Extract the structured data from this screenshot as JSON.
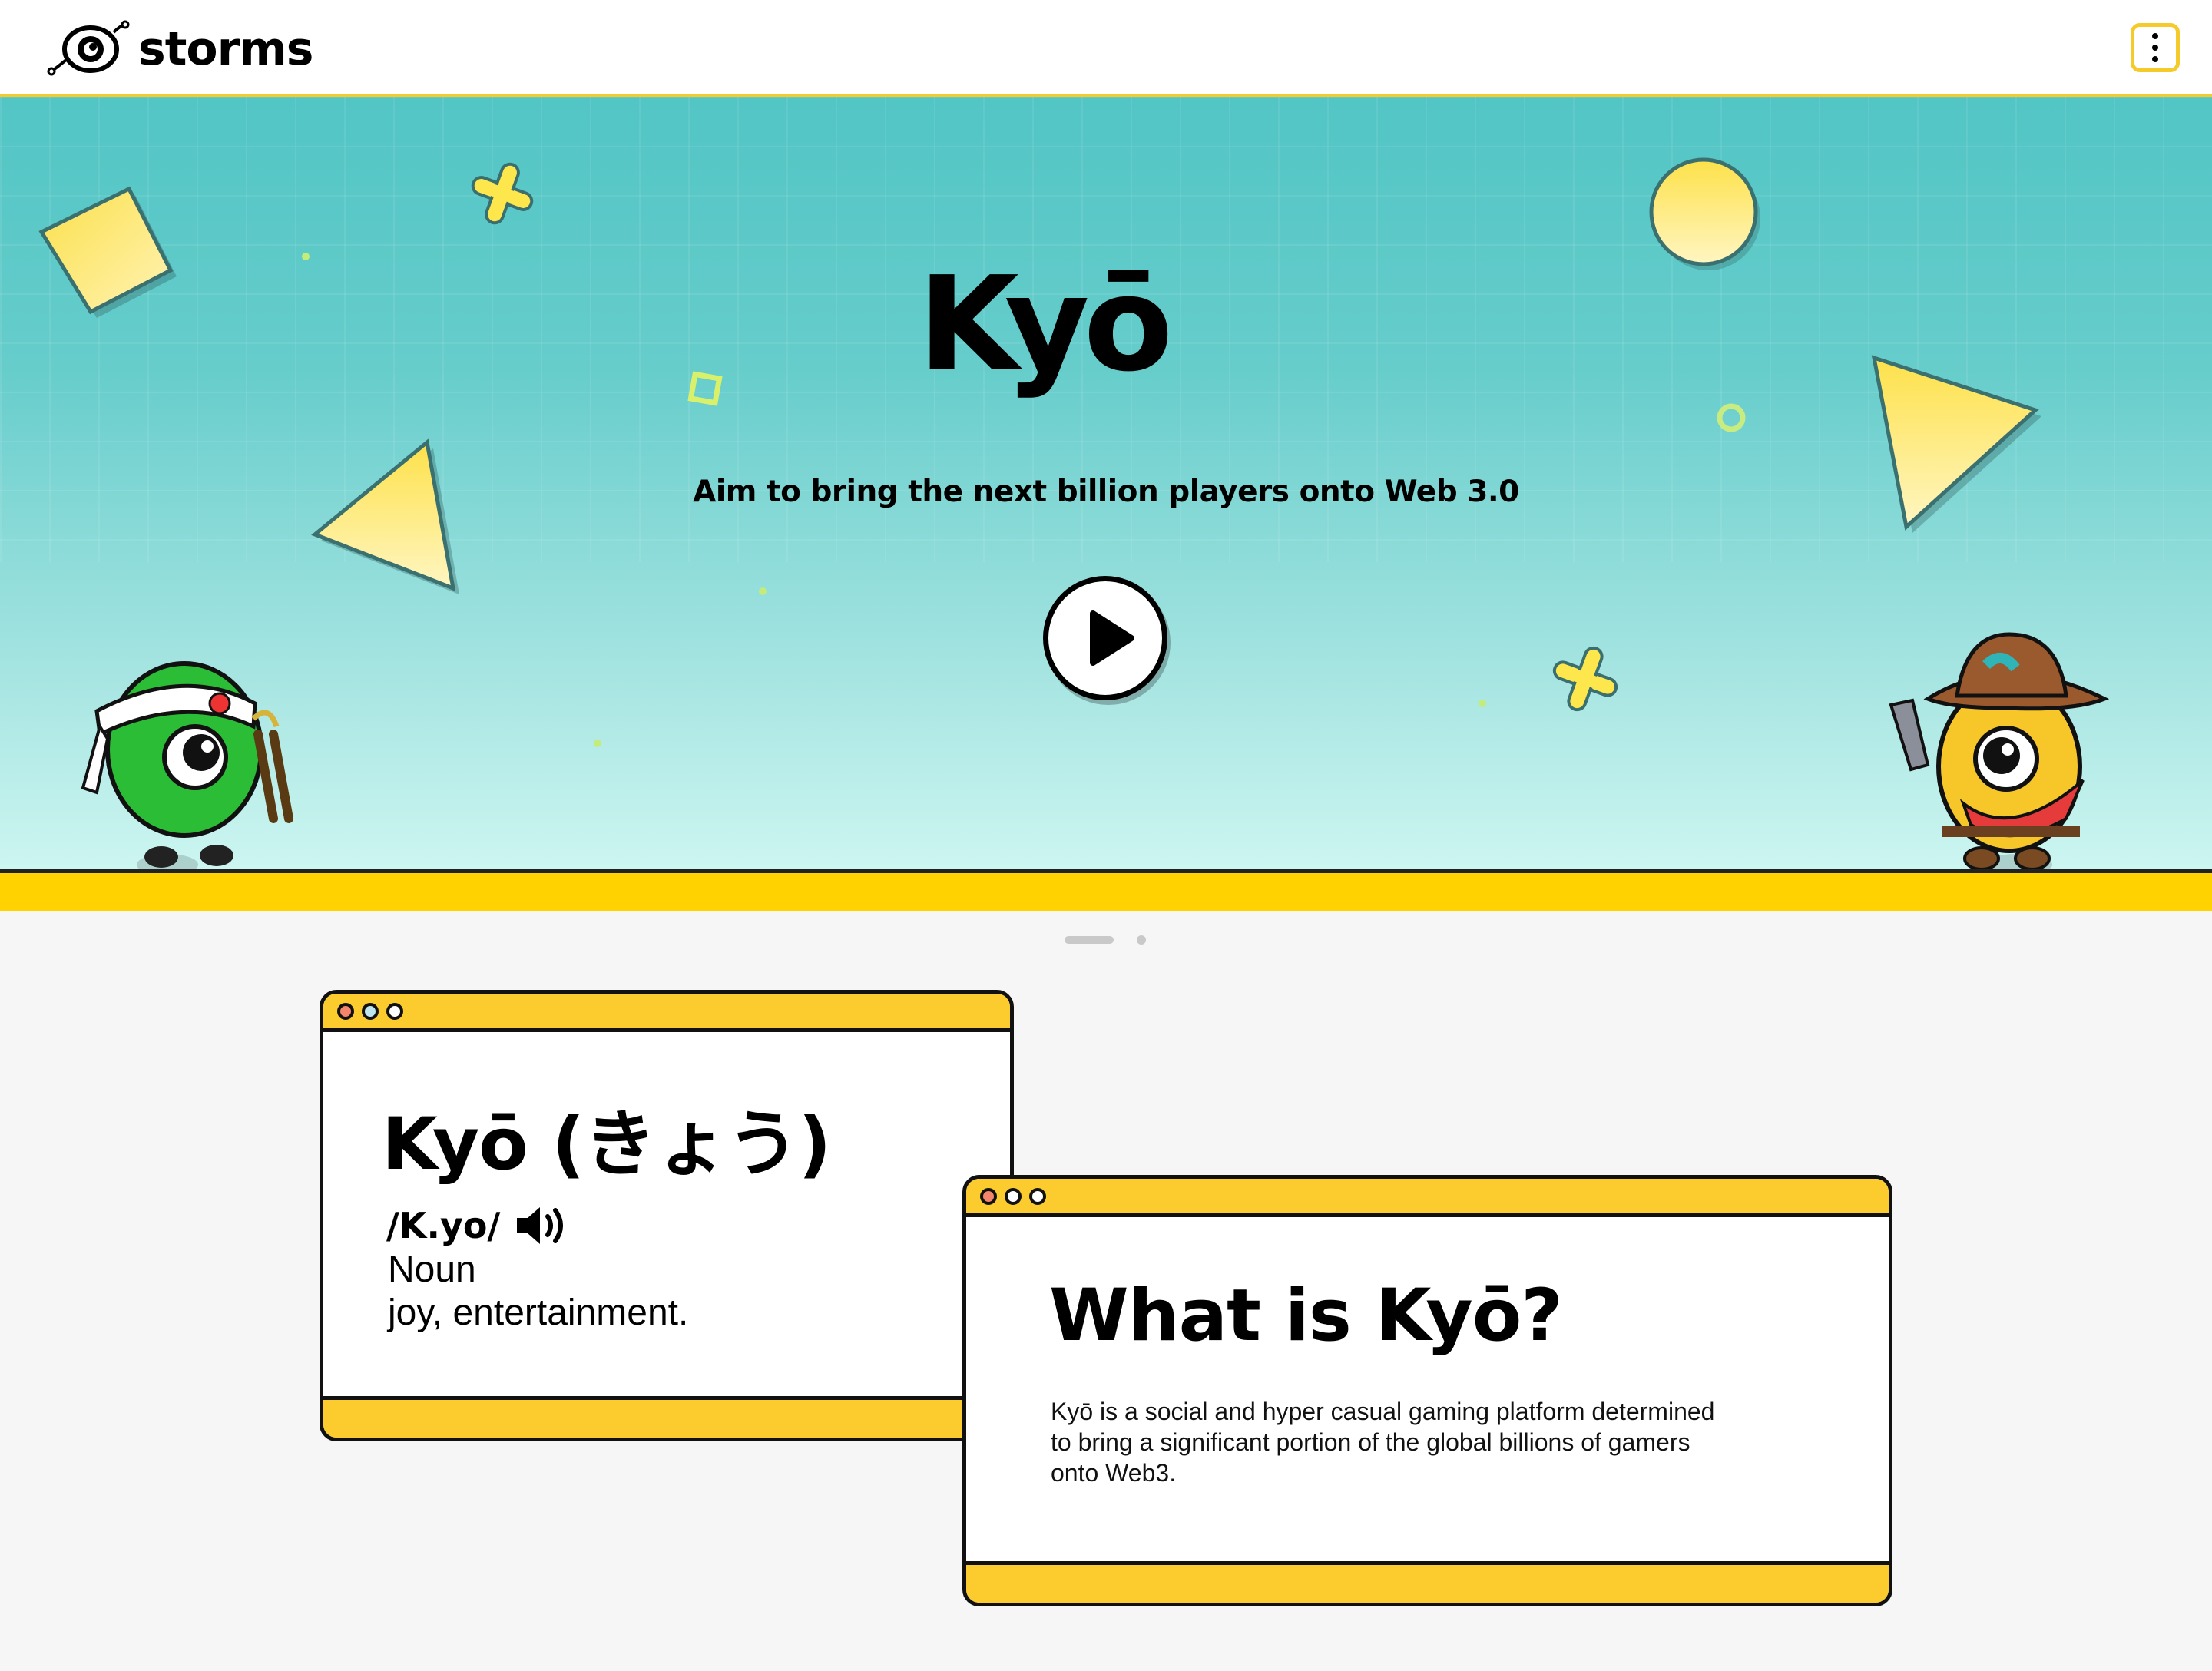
{
  "header": {
    "brand": "storms",
    "menu_icon": "more-vertical-icon"
  },
  "hero": {
    "title": "Kyō",
    "tagline": "Aim to bring the next billion players onto Web 3.0",
    "play_icon": "play-icon"
  },
  "pager": {
    "active_index": 0,
    "count": 2
  },
  "definition_card": {
    "word": "Kyō (きょう)",
    "pronunciation": "/K.yo/",
    "speaker_icon": "speaker-icon",
    "part_of_speech": "Noun",
    "meaning": "joy, entertainment."
  },
  "about_card": {
    "title": "What is Kyō?",
    "body": "Kyō is a social and hyper casual gaming platform determined to bring a significant portion of the global billions of gamers onto Web3."
  },
  "colors": {
    "accent_yellow": "#fccb2d",
    "hero_teal": "#52c5c5",
    "ground_yellow": "#ffd200"
  }
}
